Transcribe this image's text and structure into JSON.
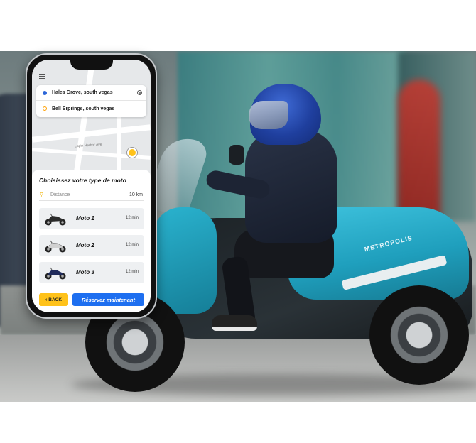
{
  "route": {
    "from": "Hales Grove, south vegas",
    "to": "Bell Srprings, south vegas"
  },
  "map": {
    "street_label": "Lapin Harbor Ave"
  },
  "sheet": {
    "title": "Choisissez votre type de moto",
    "distance_label": "Distance",
    "distance_value": "10 km"
  },
  "motos": [
    {
      "name": "Moto 1",
      "time": "12 min",
      "icon": "motorcycle-icon",
      "color": "#2b2b2b"
    },
    {
      "name": "Moto 2",
      "time": "12 min",
      "icon": "motorcycle-icon",
      "color": "#d0d0d0"
    },
    {
      "name": "Moto 3",
      "time": "12 min",
      "icon": "motorcycle-icon",
      "color": "#1f2a5a"
    }
  ],
  "actions": {
    "back_label": "BACK",
    "reserve_label": "Réservez maintenant"
  },
  "scooter": {
    "brand": "METROPOLIS"
  },
  "colors": {
    "accent_blue": "#1e6ff0",
    "accent_yellow": "#ffc21a",
    "scooter_teal": "#2ab3cf"
  }
}
